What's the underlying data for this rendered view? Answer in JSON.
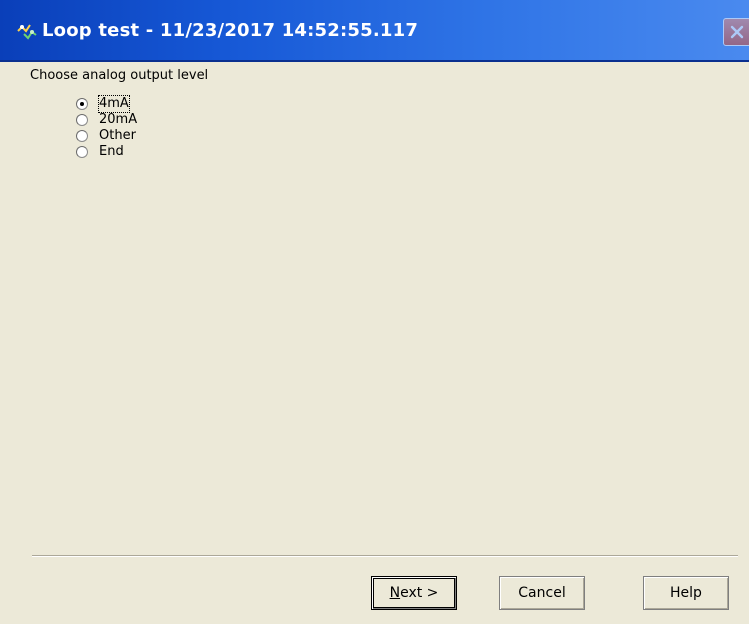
{
  "window": {
    "title": "Loop test - 11/23/2017 14:52:55.117",
    "app_icon": "loop-test-icon",
    "close_icon": "close-icon"
  },
  "prompt": "Choose analog output level",
  "options": [
    {
      "label": "4mA",
      "checked": true
    },
    {
      "label": "20mA",
      "checked": false
    },
    {
      "label": "Other",
      "checked": false
    },
    {
      "label": "End",
      "checked": false
    }
  ],
  "buttons": {
    "next_mnemonic": "N",
    "next_rest": "ext >",
    "cancel": "Cancel",
    "help": "Help"
  },
  "colors": {
    "titlebar_start": "#0a3fb9",
    "titlebar_end": "#4a8aef",
    "dialog_bg": "#ece9d8"
  }
}
